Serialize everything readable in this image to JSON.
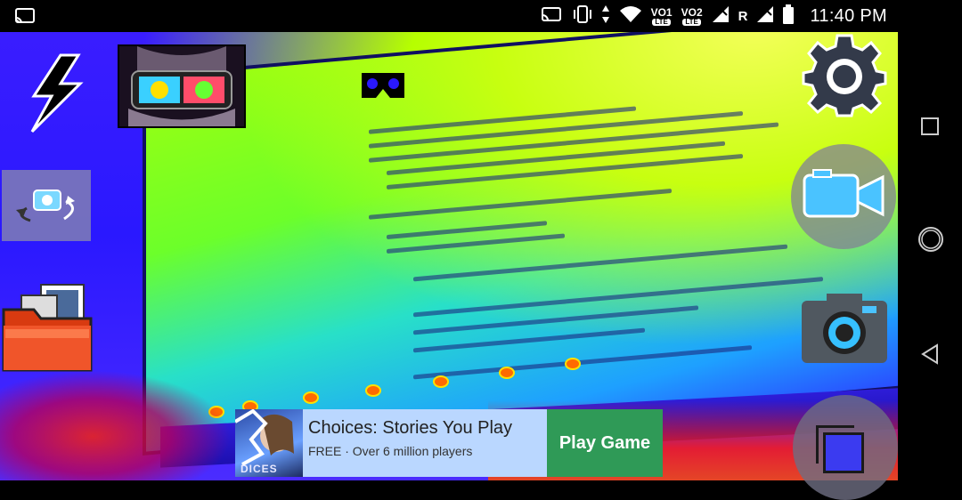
{
  "status_bar": {
    "time": "11:40 PM",
    "sim1": {
      "top": "VO1",
      "bottom": "LTE"
    },
    "sim2": {
      "top": "VO2",
      "bottom": "LTE"
    },
    "roaming": "R",
    "icons": [
      "cast-icon",
      "hotspot-icon",
      "vibrate-icon",
      "data-arrows-icon",
      "wifi-icon",
      "signal-icon",
      "signal-icon",
      "battery-icon"
    ]
  },
  "camera_controls": {
    "icons": [
      "flash-icon",
      "vr-headset-icon",
      "settings-gear-icon",
      "switch-camera-icon",
      "gallery-folder-icon",
      "video-camera-icon",
      "camera-shutter-icon",
      "recent-apps-icon"
    ]
  },
  "ad": {
    "title": "Choices: Stories You Play",
    "subtitle": "FREE · Over 6 million players",
    "cta": "Play Game",
    "icon_text": "DICES"
  },
  "navigation": {
    "icons": [
      "recents-square-icon",
      "home-circle-icon",
      "back-triangle-icon"
    ]
  },
  "colors": {
    "ad_background": "#bad7ff",
    "cta_green": "#2f9a57",
    "status_bar": "#000000",
    "filter_blue": "#2a18ff",
    "filter_yellow_green": "#b6ff00"
  }
}
